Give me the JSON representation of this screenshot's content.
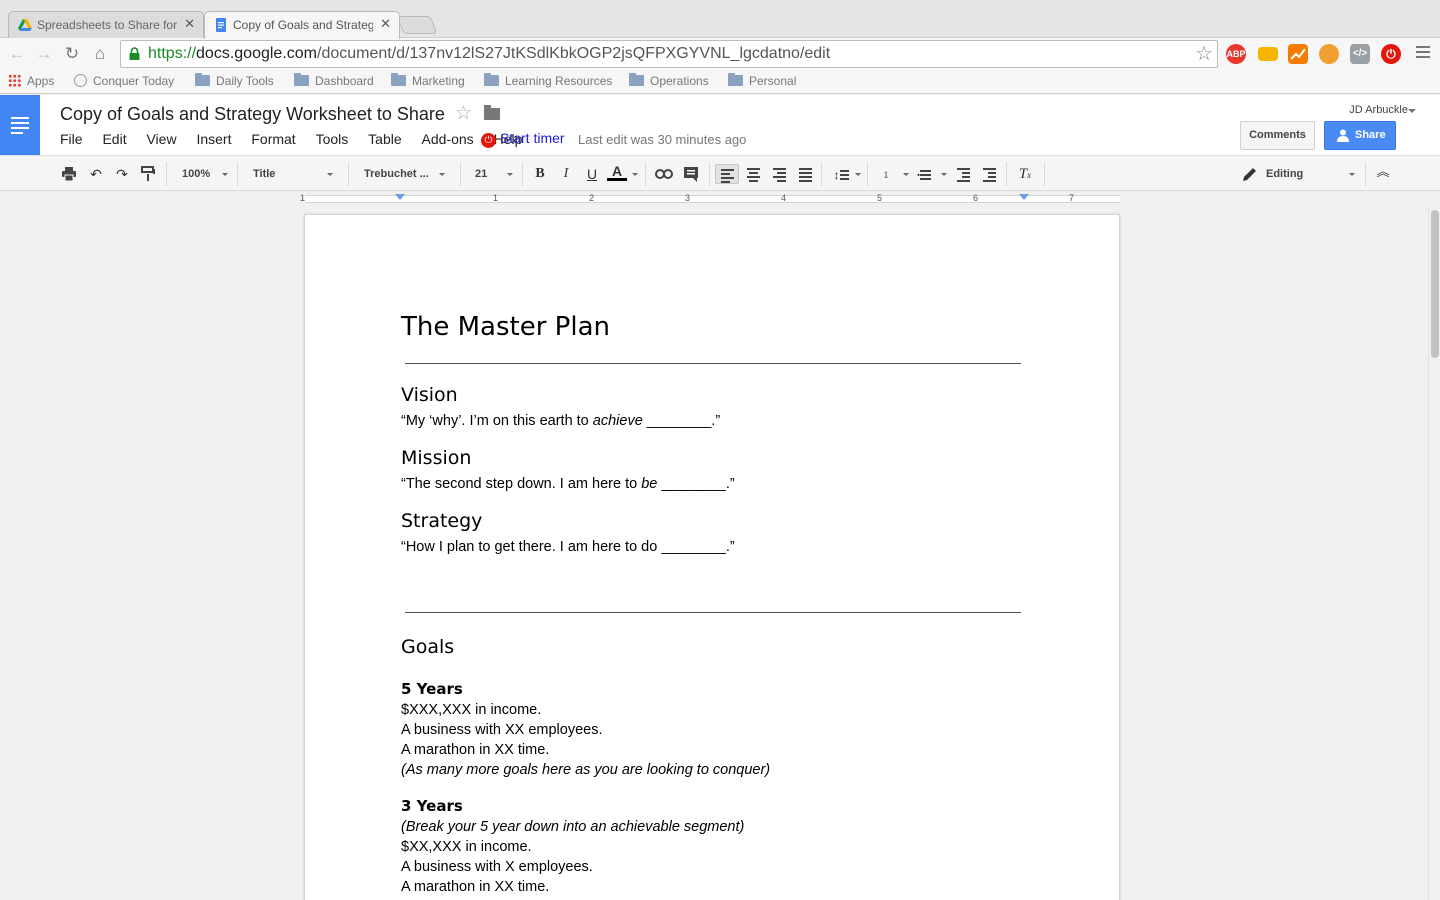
{
  "browser": {
    "tabs": [
      {
        "title": "Spreadsheets to Share for",
        "icon": "google-drive-icon",
        "active": false
      },
      {
        "title": "Copy of Goals and Strateg",
        "icon": "google-docs-icon",
        "active": true
      }
    ],
    "url": {
      "scheme": "https://",
      "host": "docs.google.com",
      "path": "/document/d/137nv12lS27JtKSdlKbkOGP2jsQFPXGYVNL_lgcdatno/edit"
    },
    "extensions": [
      {
        "label": "ABP",
        "color": "#e8372c"
      },
      {
        "label": "",
        "color": "#f4b400"
      },
      {
        "label": "",
        "color": "#f57c00"
      },
      {
        "label": "",
        "color": "#f0a030"
      },
      {
        "label": "",
        "color": "#9aa0a6"
      },
      {
        "label": "",
        "color": "#e3160b"
      }
    ],
    "bookmarks": [
      "Apps",
      "Conquer Today",
      "Daily Tools",
      "Dashboard",
      "Marketing",
      "Learning Resources",
      "Operations",
      "Personal"
    ]
  },
  "docs": {
    "title": "Copy of Goals and Strategy Worksheet to Share",
    "menu": [
      "File",
      "Edit",
      "View",
      "Insert",
      "Format",
      "Tools",
      "Table",
      "Add-ons",
      "Help"
    ],
    "timer_label": "Start timer",
    "last_edit": "Last edit was 30 minutes ago",
    "user": "JD Arbuckle",
    "comments_label": "Comments",
    "share_label": "Share",
    "accent": "#4285f4"
  },
  "toolbar": {
    "zoom": "100%",
    "style": "Title",
    "font": "Trebuchet ...",
    "size": "21",
    "mode": "Editing"
  },
  "ruler": {
    "numbers": [
      "1",
      "1",
      "2",
      "3",
      "4",
      "5",
      "6",
      "7"
    ]
  },
  "document": {
    "heading": "The Master Plan",
    "vision": {
      "title": "Vision",
      "pre": "“My ‘why’. I’m on this earth to ",
      "em": "achieve",
      "post": " ________.”"
    },
    "mission": {
      "title": "Mission",
      "pre": "“The second step down. I am here to ",
      "em": "be",
      "post": " ________.”"
    },
    "strategy": {
      "title": "Strategy",
      "text": "“How I plan to get there. I am here to do ________.”"
    },
    "goals_title": "Goals",
    "five_years": {
      "title": "5 Years",
      "lines": [
        "$XXX,XXX in income.",
        "A business with XX employees.",
        "A marathon in XX time."
      ],
      "note": "(As many more goals here as you are looking to conquer)"
    },
    "three_years": {
      "title": "3 Years",
      "note": "(Break your 5 year down into an achievable segment)",
      "lines": [
        "$XX,XXX in income.",
        "A business with X employees.",
        "A marathon in XX time."
      ]
    }
  }
}
